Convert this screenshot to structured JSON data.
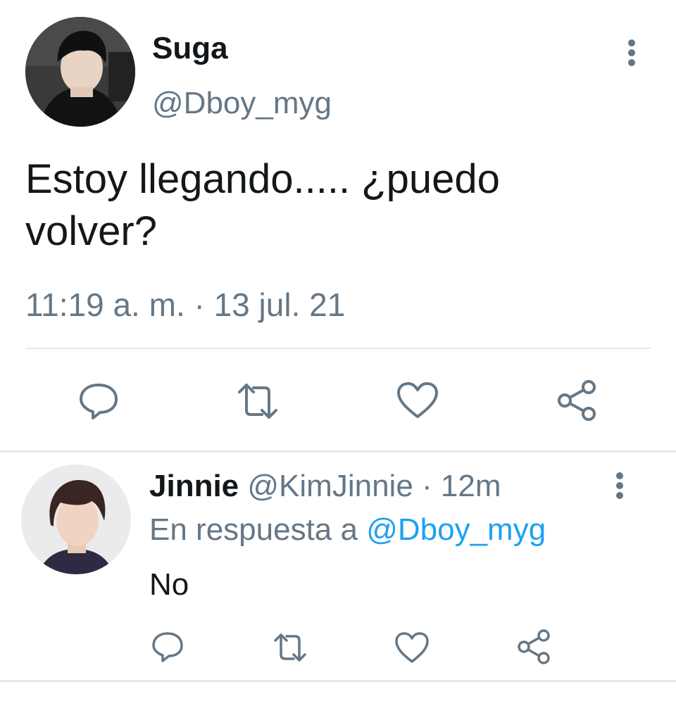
{
  "main_tweet": {
    "author_name": "Suga",
    "author_handle": "@Dboy_myg",
    "text": "Estoy llegando..... ¿puedo volver?",
    "timestamp": "11:19 a. m. · 13 jul. 21",
    "avatar_icon": "profile-photo",
    "more_icon": "more-vertical-icon",
    "actions": [
      {
        "name": "reply",
        "icon": "comment-icon"
      },
      {
        "name": "retweet",
        "icon": "retweet-icon"
      },
      {
        "name": "like",
        "icon": "heart-icon"
      },
      {
        "name": "share",
        "icon": "share-icon"
      }
    ]
  },
  "reply_tweet": {
    "author_name": "Jinnie",
    "author_handle": "@KimJinnie",
    "separator": "·",
    "time": "12m",
    "reply_prefix": "En respuesta a",
    "reply_mention": "@Dboy_myg",
    "text": "No",
    "avatar_icon": "profile-photo",
    "more_icon": "more-vertical-icon",
    "actions": [
      {
        "name": "reply",
        "icon": "comment-icon"
      },
      {
        "name": "retweet",
        "icon": "retweet-icon"
      },
      {
        "name": "like",
        "icon": "heart-icon"
      },
      {
        "name": "share",
        "icon": "share-icon"
      }
    ]
  },
  "colors": {
    "text_primary": "#14171a",
    "text_secondary": "#657786",
    "link": "#1da1f2",
    "icon": "#657786",
    "divider": "#e1e8ed"
  }
}
